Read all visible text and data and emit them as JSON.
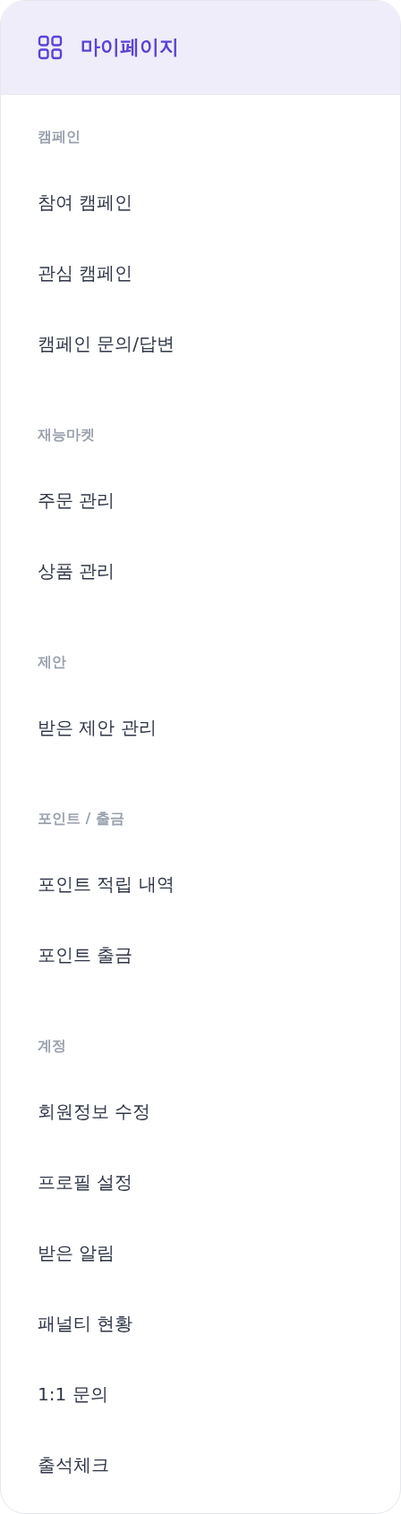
{
  "header": {
    "title": "마이페이지"
  },
  "sections": [
    {
      "label": "캠페인",
      "items": [
        "참여 캠페인",
        "관심 캠페인",
        "캠페인 문의/답변"
      ]
    },
    {
      "label": "재능마켓",
      "items": [
        "주문 관리",
        "상품 관리"
      ]
    },
    {
      "label": "제안",
      "items": [
        "받은 제안 관리"
      ]
    },
    {
      "label": "포인트 / 출금",
      "items": [
        "포인트 적립 내역",
        "포인트 출금"
      ]
    },
    {
      "label": "계정",
      "items": [
        "회원정보 수정",
        "프로필 설정",
        "받은 알림",
        "패널티 현황",
        "1:1 문의",
        "출석체크"
      ]
    }
  ]
}
